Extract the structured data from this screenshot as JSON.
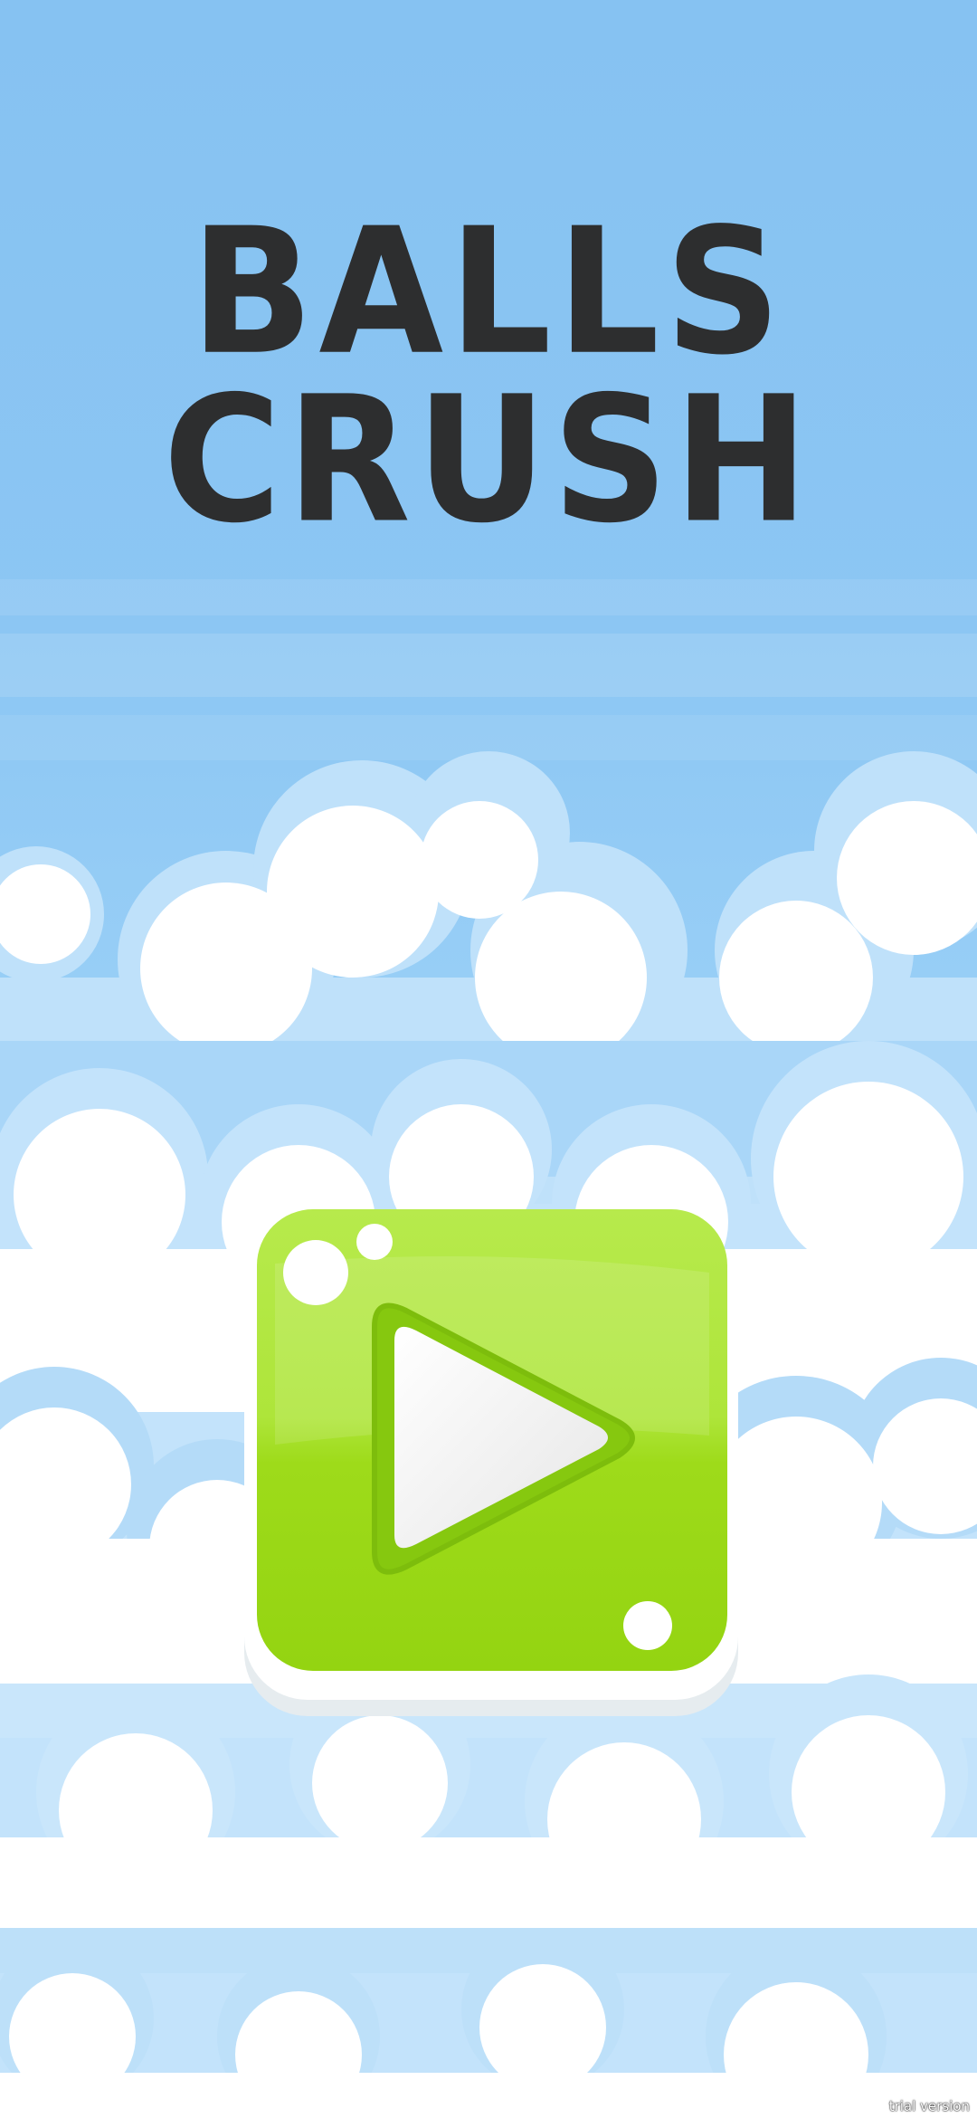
{
  "game": {
    "title_line1": "BALLS",
    "title_line2": "CRUSH"
  },
  "play_button": {
    "icon": "play-icon",
    "color": "#9fdc1c"
  },
  "watermark": "trial version",
  "colors": {
    "sky": "#88c3f2",
    "title_text": "#2d2e2f",
    "cloud": "#ffffff",
    "cloud_shade": "#cfe9fb",
    "button_green": "#9fdc1c",
    "button_light": "#b9ec50"
  }
}
